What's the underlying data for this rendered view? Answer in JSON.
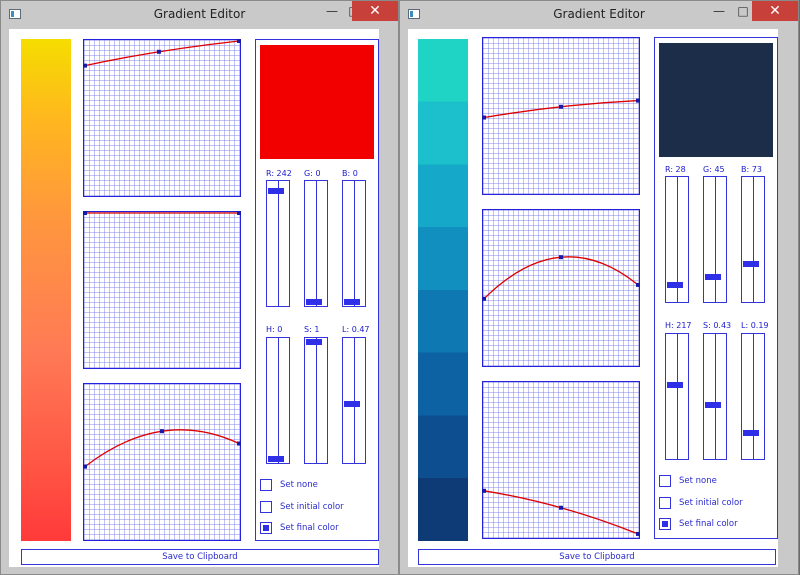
{
  "windows": [
    {
      "title": "Gradient Editor",
      "save_label": "Save to Clipboard",
      "gradient_css": "linear-gradient(to bottom,#f5dd00 0%,#ffb71e 16%,#ff983d 35%,#ff7a55 62%,#ff5745 84%,#ff3a3a 100%)",
      "swatch_color": "#f20000",
      "rgb": {
        "r_label": "R: 242",
        "g_label": "G: 0",
        "b_label": "B: 0",
        "r": 0.95,
        "g": 0.0,
        "b": 0.0
      },
      "hsl": {
        "h_label": "H: 0",
        "s_label": "S: 1",
        "l_label": "L: 0.47",
        "h": 0.0,
        "s": 1.0,
        "l": 0.47
      },
      "graphs": [
        {
          "points": [
            [
              0,
              0.84
            ],
            [
              0.48,
              0.93
            ],
            [
              1,
              1.0
            ]
          ]
        },
        {
          "points": [
            [
              0,
              1.0
            ],
            [
              1,
              1.0
            ]
          ]
        },
        {
          "points": [
            [
              0,
              0.47
            ],
            [
              0.5,
              0.7
            ],
            [
              1,
              0.62
            ]
          ]
        }
      ],
      "options": [
        {
          "label": "Set none",
          "checked": false
        },
        {
          "label": "Set initial color",
          "checked": false
        },
        {
          "label": "Set final color",
          "checked": true
        }
      ]
    },
    {
      "title": "Gradient Editor",
      "save_label": "Save to Clipboard",
      "gradient_steps": [
        "#1fd3c5",
        "#1cbfcc",
        "#15a8c8",
        "#1190c0",
        "#0d78b2",
        "#0d62a3",
        "#0c4e8f",
        "#0e3b75"
      ],
      "swatch_color": "#1c2d49",
      "rgb": {
        "r_label": "R: 28",
        "g_label": "G: 45",
        "b_label": "B: 73",
        "r": 0.11,
        "g": 0.18,
        "b": 0.29
      },
      "hsl": {
        "h_label": "H: 217",
        "s_label": "S: 0.43",
        "l_label": "L: 0.19",
        "h": 0.6,
        "s": 0.43,
        "l": 0.19
      },
      "graphs": [
        {
          "points": [
            [
              0,
              0.49
            ],
            [
              0.5,
              0.56
            ],
            [
              1,
              0.6
            ]
          ]
        },
        {
          "points": [
            [
              0,
              0.43
            ],
            [
              0.5,
              0.7
            ],
            [
              1,
              0.52
            ]
          ]
        },
        {
          "points": [
            [
              0,
              0.3
            ],
            [
              0.5,
              0.19
            ],
            [
              1,
              0.02
            ]
          ]
        }
      ],
      "options": [
        {
          "label": "Set none",
          "checked": false
        },
        {
          "label": "Set initial color",
          "checked": false
        },
        {
          "label": "Set final color",
          "checked": true
        }
      ]
    }
  ],
  "titlebar": {
    "minimize_glyph": "—",
    "maximize_glyph": "□",
    "close_glyph": "✕"
  },
  "colors": {
    "accent": "#2f2fe8",
    "curve": "#dd0000",
    "close_button": "#c7403a"
  }
}
